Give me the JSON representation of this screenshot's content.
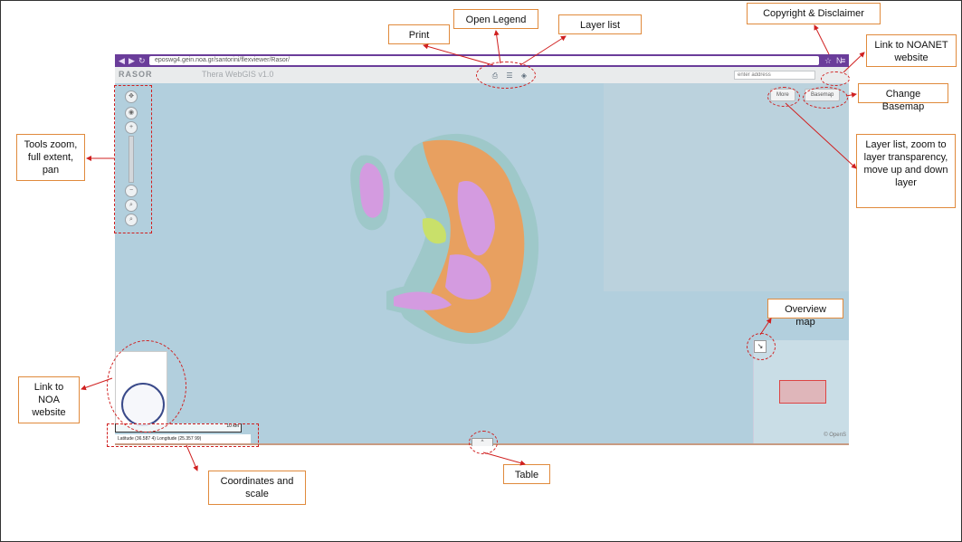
{
  "browser": {
    "url": "eposwg4.gein.noa.gr/santorini/flexviewer/Rasor/"
  },
  "app": {
    "logo": "RASOR",
    "title": "Thera WebGIS v1.0",
    "address_placeholder": "enter address",
    "more_label": "More",
    "basemap_label": "Basemap",
    "coords_text": "Latitude (36.587 4) Longitude (25.357 99)",
    "scale_text": "10 km",
    "attribution": "© OpenS",
    "table_label": "^"
  },
  "annotations": {
    "print": "Print",
    "open_legend": "Open Legend",
    "layer_list": "Layer list",
    "copyright": "Copyright & Disclaimer",
    "noanet": "Link to NOANET website",
    "change_basemap": "Change Basemap",
    "layer_tools": "Layer list, zoom to layer transparency, move up and down layer",
    "tools_zoom": "Tools zoom, full extent, pan",
    "overview_map": "Overview map",
    "noa_link": "Link to NOA website",
    "coords_scale": "Coordinates and scale",
    "table": "Table"
  },
  "colors": {
    "annotation_border": "#e08a3c",
    "callout_red": "#d02020",
    "browser_purple": "#6a3d9a",
    "sea": "#b2cfdd"
  }
}
